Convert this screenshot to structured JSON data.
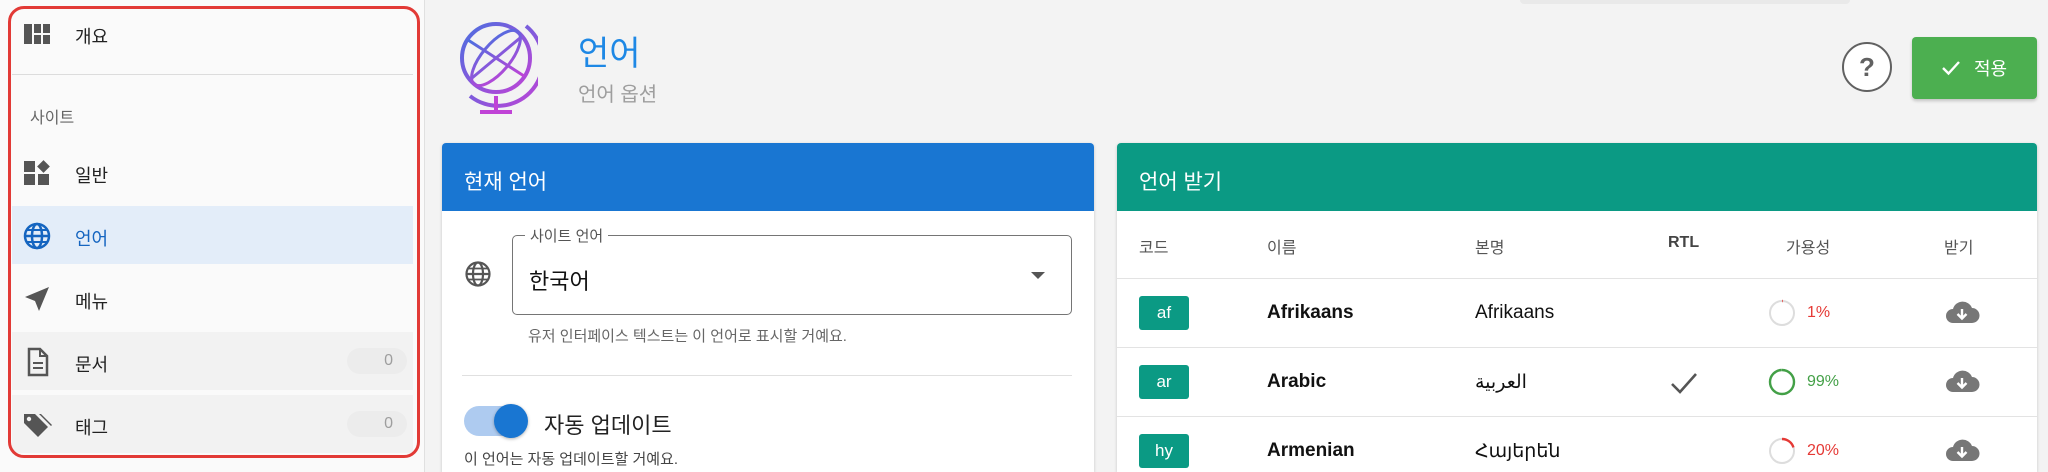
{
  "sidebar": {
    "overview_label": "개요",
    "section_title": "사이트",
    "items": [
      {
        "label": "일반",
        "icon": "dashboard-widgets-icon"
      },
      {
        "label": "언어",
        "icon": "globe-icon"
      },
      {
        "label": "메뉴",
        "icon": "navigation-arrow-icon"
      },
      {
        "label": "문서",
        "icon": "document-icon",
        "count": "0"
      },
      {
        "label": "태그",
        "icon": "tags-icon",
        "count": "0"
      }
    ]
  },
  "header": {
    "title": "언어",
    "subtitle": "언어 옵션",
    "help_label": "?",
    "apply_label": "적용"
  },
  "current_language": {
    "title": "현재 언어",
    "site_language_label": "사이트 언어",
    "site_language_value": "한국어",
    "site_language_helper": "유저 인터페이스 텍스트는 이 언어로 표시할 거예요.",
    "auto_update_label": "자동 업데이트",
    "auto_update_on": true,
    "auto_update_helper": "이 언어는 자동 업데이트할 거예요."
  },
  "receive_languages": {
    "title": "언어 받기",
    "columns": [
      "코드",
      "이름",
      "본명",
      "RTL",
      "가용성",
      "받기"
    ],
    "rows": [
      {
        "code": "af",
        "name": "Afrikaans",
        "native": "Afrikaans",
        "rtl": false,
        "availability": "1%",
        "availability_value": 1,
        "status_color": "#e53935"
      },
      {
        "code": "ar",
        "name": "Arabic",
        "native": "العربية",
        "rtl": true,
        "availability": "99%",
        "availability_value": 99,
        "status_color": "#43a047"
      },
      {
        "code": "hy",
        "name": "Armenian",
        "native": "Հայերեն",
        "rtl": false,
        "availability": "20%",
        "availability_value": 20,
        "status_color": "#e53935"
      }
    ]
  },
  "colors": {
    "primary": "#1976d2",
    "teal": "#0b9a84",
    "apply_green": "#4caf50",
    "highlight_red": "#e23a36"
  }
}
